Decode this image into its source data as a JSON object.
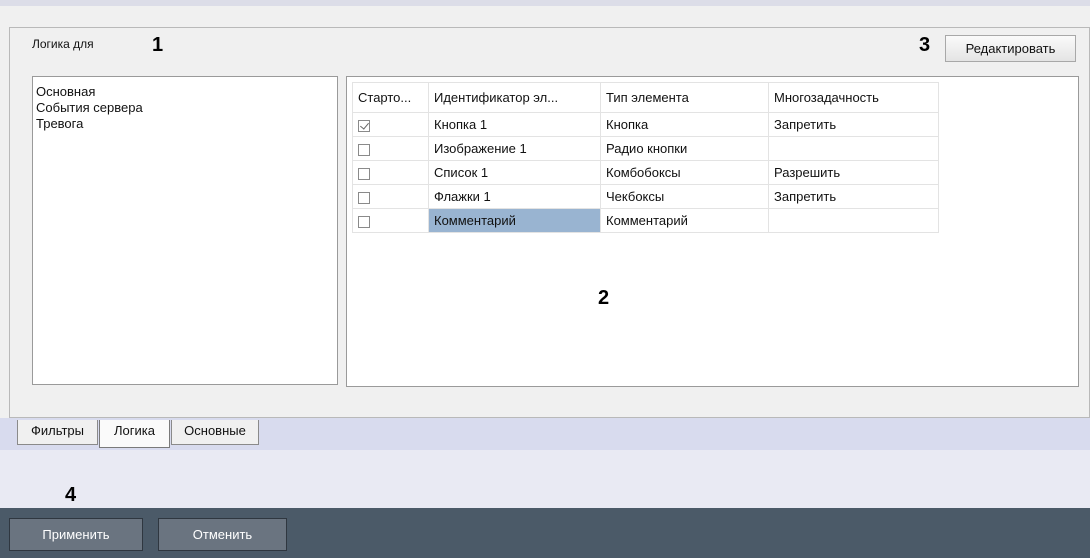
{
  "markers": {
    "m1": "1",
    "m2": "2",
    "m3": "3",
    "m4": "4"
  },
  "panel": {
    "logic_for_label": "Логика для",
    "edit_button": "Редактировать",
    "logic_list": [
      "Основная",
      "События сервера",
      "Тревога"
    ]
  },
  "grid": {
    "columns": [
      "Старто...",
      "Идентификатор эл...",
      "Тип элемента",
      "Многозадачность"
    ],
    "rows": [
      {
        "startup": true,
        "id": "Кнопка 1",
        "type": "Кнопка",
        "multitask": "Запретить"
      },
      {
        "startup": false,
        "id": "Изображение 1",
        "type": "Радио кнопки",
        "multitask": ""
      },
      {
        "startup": false,
        "id": "Список 1",
        "type": "Комбобоксы",
        "multitask": "Разрешить"
      },
      {
        "startup": false,
        "id": "Флажки 1",
        "type": "Чекбоксы",
        "multitask": "Запретить"
      },
      {
        "startup": false,
        "id": "Комментарий",
        "type": "Комментарий",
        "multitask": ""
      }
    ],
    "selected_cell": "row 5, identifier"
  },
  "tabs": {
    "filters": "Фильтры",
    "logic": "Логика",
    "main": "Основные",
    "active": "Логика"
  },
  "footer": {
    "apply": "Применить",
    "cancel": "Отменить"
  },
  "colors": {
    "selection": "#99b4d1",
    "bottom_bar": "#4b5a68",
    "tab_strip": "#d8dbee"
  }
}
